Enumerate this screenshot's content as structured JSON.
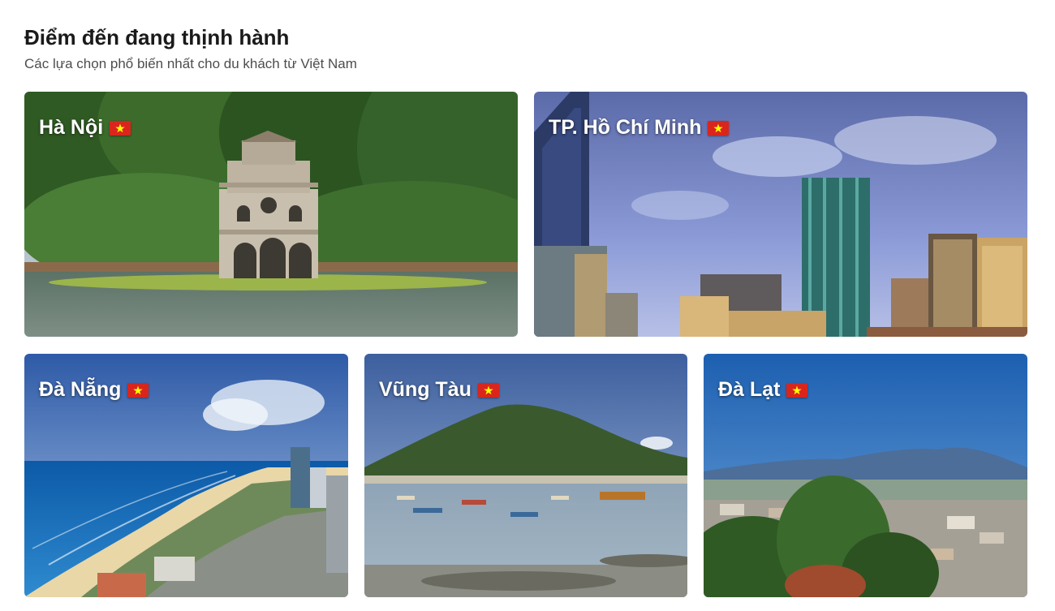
{
  "section": {
    "title": "Điểm đến đang thịnh hành",
    "subtitle": "Các lựa chọn phổ biến nhất cho du khách từ Việt Nam"
  },
  "destinations": [
    {
      "name": "Hà Nội",
      "flag_icon": "vietnam-flag-icon"
    },
    {
      "name": "TP. Hồ Chí Minh",
      "flag_icon": "vietnam-flag-icon"
    },
    {
      "name": "Đà Nẵng",
      "flag_icon": "vietnam-flag-icon"
    },
    {
      "name": "Vũng Tàu",
      "flag_icon": "vietnam-flag-icon"
    },
    {
      "name": "Đà Lạt",
      "flag_icon": "vietnam-flag-icon"
    }
  ],
  "colors": {
    "flag_red": "#da251d",
    "flag_star": "#ffff00",
    "title_text": "#1a1a1a",
    "subtitle_text": "#4d4d4d"
  }
}
